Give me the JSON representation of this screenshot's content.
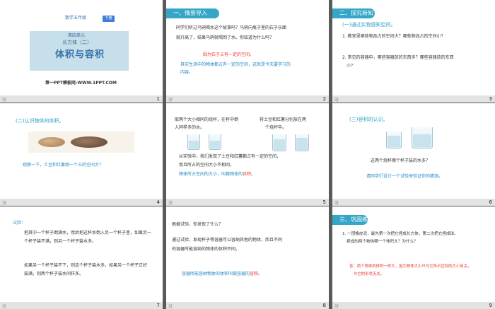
{
  "slides": [
    {
      "number": "1",
      "grade": "数学五年级",
      "term": "下册",
      "unit": "第四单元",
      "chapter": "长方体（二）",
      "title": "体积与容积",
      "site": "第一PPT模板网-WWW.1PPT.COM"
    },
    {
      "number": "2",
      "header": "一、情景导入",
      "para": [
        "同学们听过乌鸦喝水这个故事吗？乌鸦向瓶子里的石子乐面",
        "就升高了，结果乌鸦就喝到了水。你知道为什么吗？"
      ],
      "red": "因为石子占有一定的空间。",
      "blue": [
        "其实生活中的物体都占有一定的空间，这就是今天要学习的",
        "内容。"
      ]
    },
    {
      "number": "3",
      "header": "二、探究新知",
      "sub": "(一)通过实物感知空间。",
      "q1": "1. 教室里哪些物品占的空间大？哪些物品占的空间小？",
      "q2": [
        "2. 常见的容器中，哪些容器放的东西多？哪些容器放的东西",
        "少？"
      ]
    },
    {
      "number": "4",
      "sub": "(二)认识物体的体积。",
      "question": "观察一下，土豆和红薯哪一个占的空间大？"
    },
    {
      "number": "5",
      "top_left": [
        "取两个大小相同的烧杯，在杯中倒",
        "入同样多的水。"
      ],
      "top_right": [
        "将土豆和红薯分别放在两",
        "个烧杯中。"
      ],
      "mid": [
        "从实验中，我们发现了土豆和红薯都占有一定的空间，",
        "而且所占的空间大小不相同。"
      ],
      "conclusion_prefix": "物体所占空间的大小，叫做物体的",
      "conclusion_key": "体积",
      "conclusion_suffix": "。"
    },
    {
      "number": "6",
      "sub": "(三)容积的认识。",
      "question": "这两个烧杯哪个杯子装的水多？",
      "task": "请同学们设计一个试验来验证你的猜测。"
    },
    {
      "number": "7",
      "title": "试验：",
      "p1": [
        "把其中一个杯子倒满水，然后把这杯水倒入另一个杯子里，如果另一",
        "个杯子装不满，则另一个杯子装水多。"
      ],
      "p2": [
        "如果另一个杯子装不下，则这个杯子装水多，如果另一个杯子正好",
        "装满，则两个杯子装水同样多。"
      ]
    },
    {
      "number": "8",
      "q": "根据试验，你发现了什么？",
      "p": [
        "通过试验，发现杯子等容器可以容纳其他的物体，而且不同",
        "的容器所能容纳的物体的体积不同。"
      ],
      "conclusion_prefix": "容器所能容纳物体的体积叫做容器的",
      "conclusion_key": "容积",
      "conclusion_suffix": "。"
    },
    {
      "number": "9",
      "header": "三、巩固练习",
      "q": [
        "1. 一团橡皮泥，最先第一次把它捏成长方体，第二次把它捏成球。",
        "捏成的两个物体哪一个体积大？为什么？"
      ],
      "answer": [
        "答：两个物体的体积一样大，因为物体大小只与它所占空间的大小有关，",
        "与它的形状无关。"
      ]
    }
  ],
  "footer_label": "汾"
}
